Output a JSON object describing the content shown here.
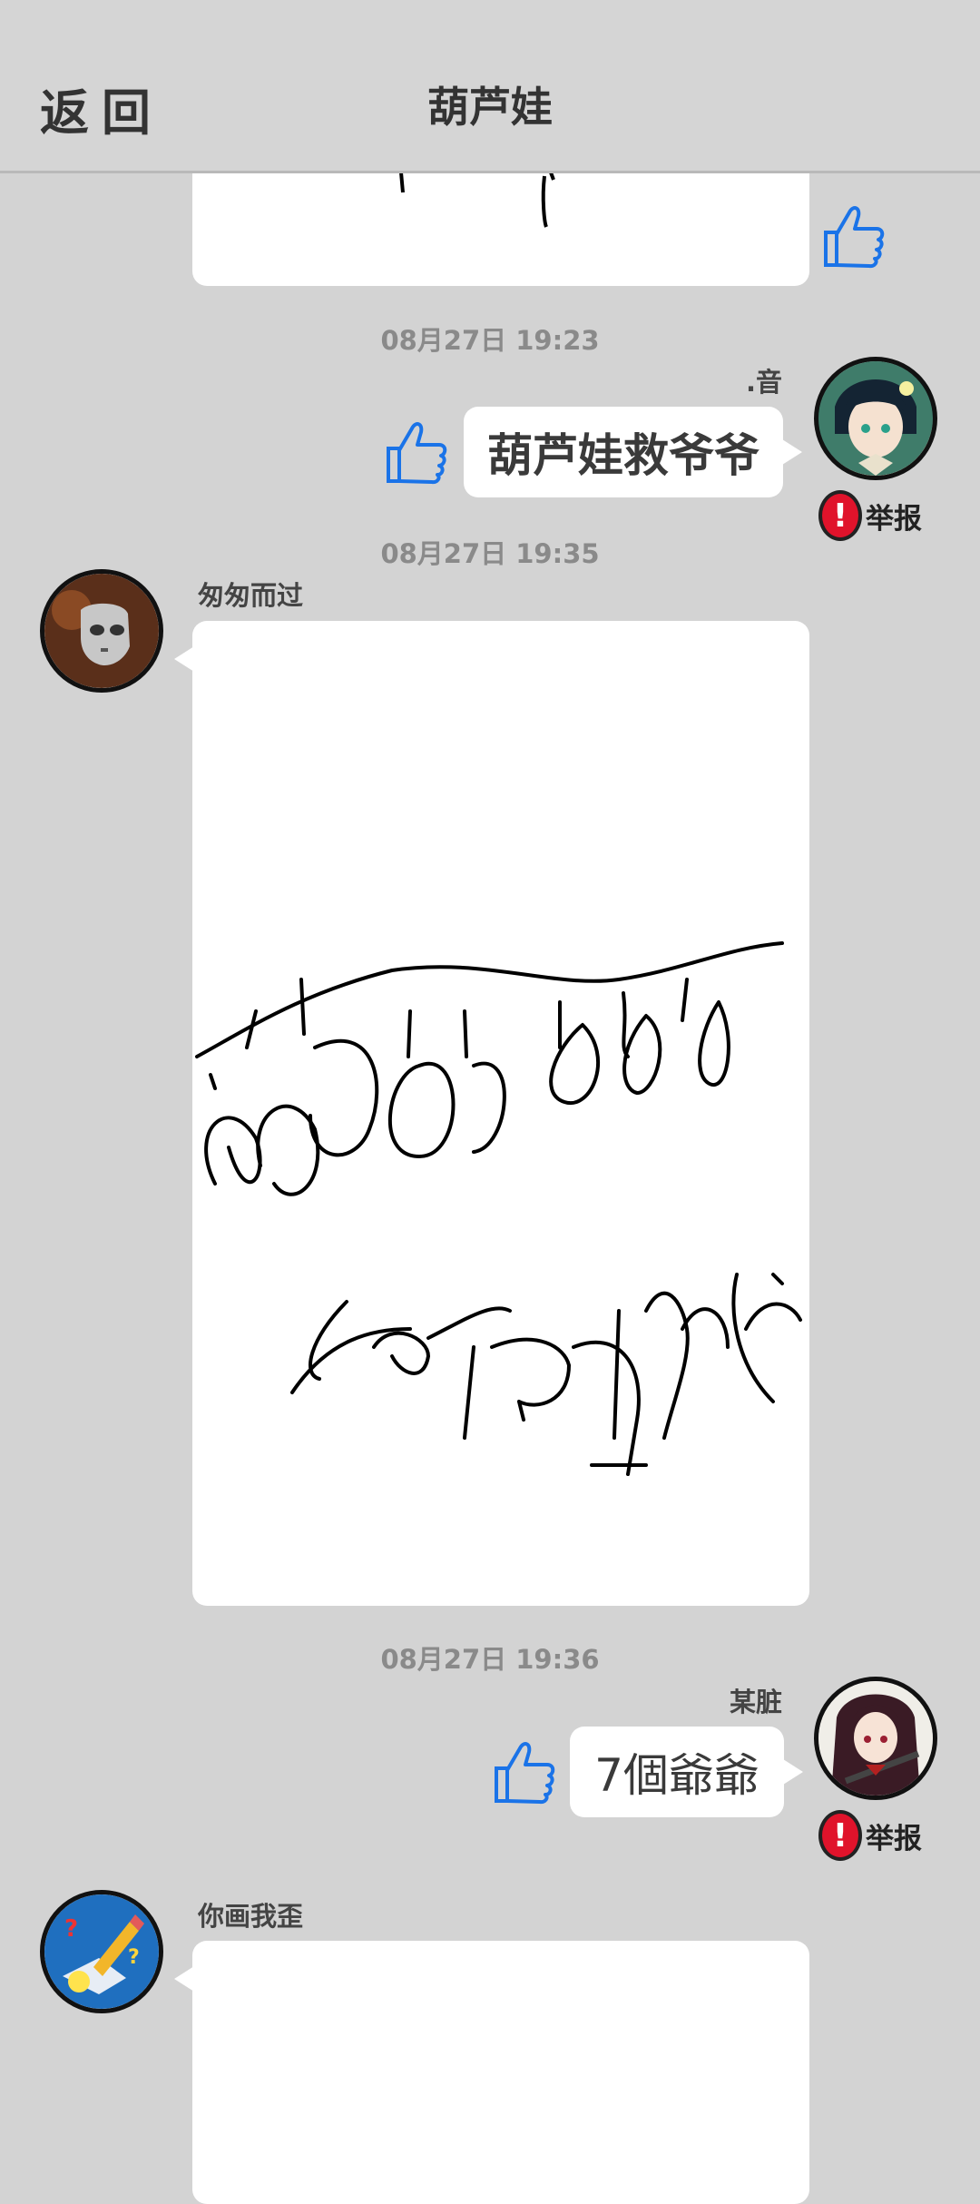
{
  "header": {
    "back_label": "返回",
    "title": "葫芦娃"
  },
  "timestamps": [
    "08月27日  19:23",
    "08月27日  19:35",
    "08月27日  19:36"
  ],
  "messages": [
    {
      "user": ".音",
      "text": "葫芦娃救爷爷",
      "report_label": "举报"
    },
    {
      "user": "匆匆而过"
    },
    {
      "user": "某脏",
      "text": "7個爺爺",
      "report_label": "举报"
    },
    {
      "user": "你画我歪"
    }
  ],
  "colors": {
    "background": "#d3d3d3",
    "thumb_blue": "#1a73e8",
    "report_red": "#e0132b"
  },
  "icons": [
    "back-icon",
    "thumbs-up-icon",
    "report-icon"
  ]
}
